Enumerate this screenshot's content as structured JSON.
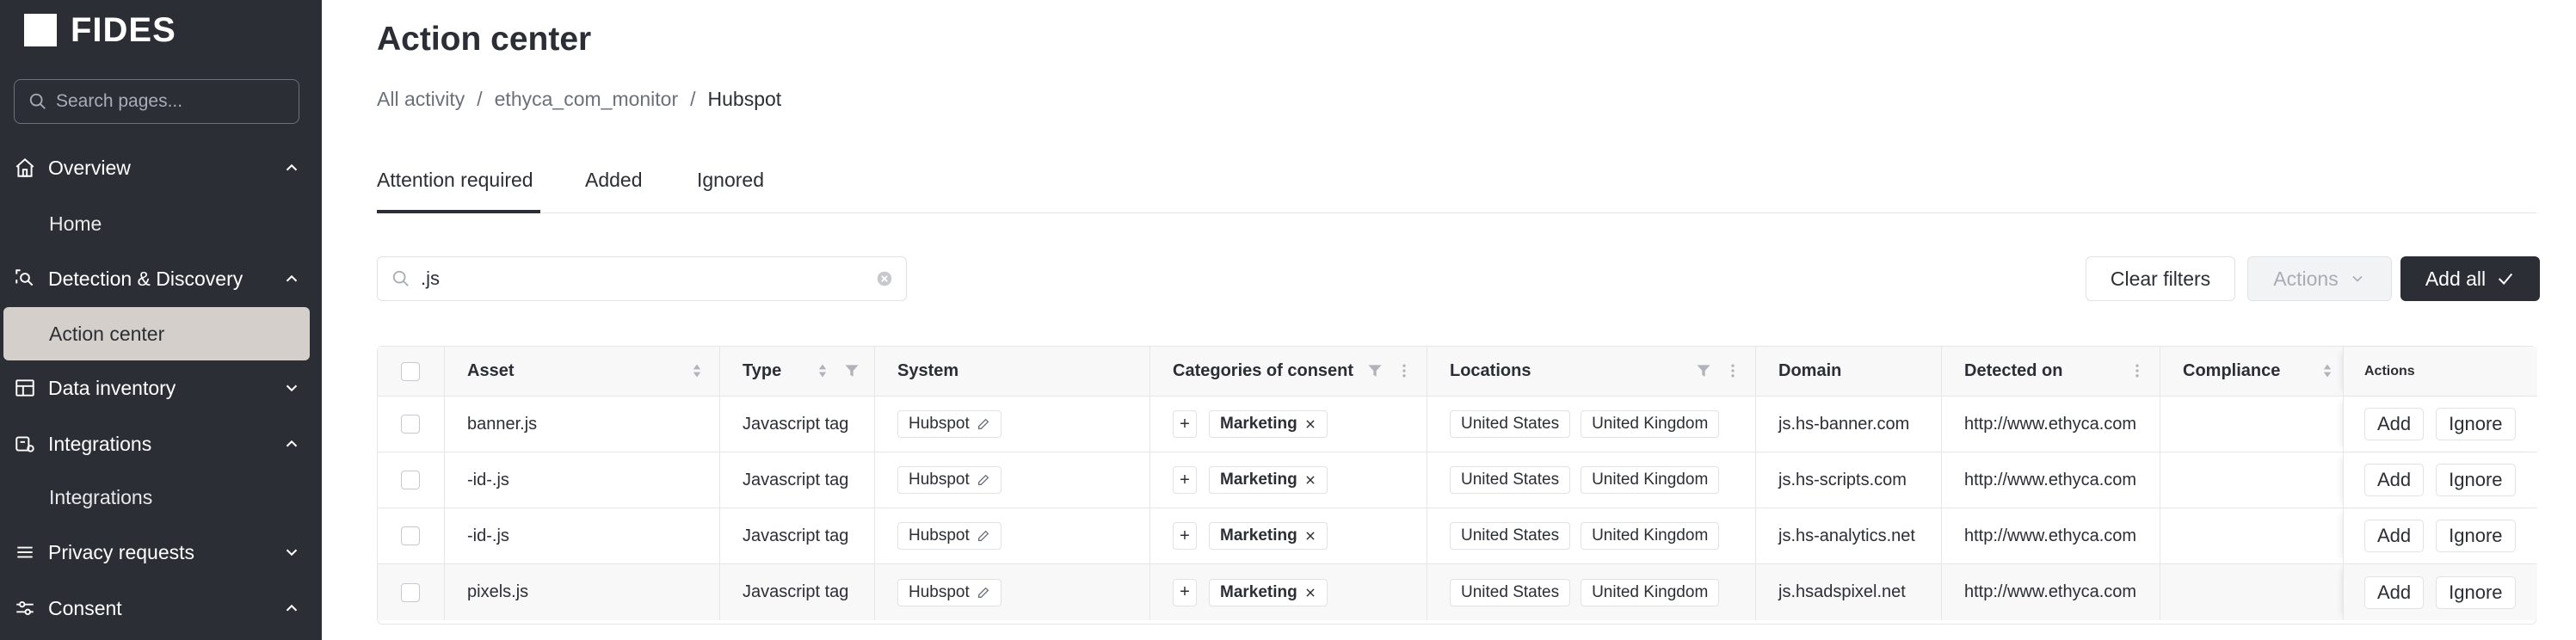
{
  "sidebar": {
    "logo_text": "FIDES",
    "search_placeholder": "Search pages...",
    "groups": [
      {
        "label": "Overview",
        "icon": "home-icon",
        "expanded": true
      },
      {
        "label": "Home"
      },
      {
        "label": "Detection & Discovery",
        "icon": "scan-search-icon",
        "expanded": true
      },
      {
        "label": "Action center",
        "active": true
      },
      {
        "label": "Data inventory",
        "icon": "table-icon",
        "expanded": false
      },
      {
        "label": "Integrations",
        "icon": "plug-icon",
        "expanded": true
      },
      {
        "label": "Integrations"
      },
      {
        "label": "Privacy requests",
        "icon": "stack-icon",
        "expanded": false
      },
      {
        "label": "Consent",
        "icon": "sliders-icon",
        "expanded": true
      }
    ]
  },
  "header": {
    "title": "Action center",
    "breadcrumb": [
      "All activity",
      "ethyca_com_monitor",
      "Hubspot"
    ],
    "breadcrumb_sep": "/"
  },
  "tabs": [
    {
      "label": "Attention required",
      "active": true
    },
    {
      "label": "Added"
    },
    {
      "label": "Ignored"
    }
  ],
  "toolbar": {
    "search_value": ".js",
    "clear_filters": "Clear filters",
    "actions": "Actions",
    "add_all": "Add all"
  },
  "table": {
    "columns": [
      "Asset",
      "Type",
      "System",
      "Categories of consent",
      "Locations",
      "Domain",
      "Detected on",
      "Compliance",
      "Actions"
    ],
    "rows": [
      {
        "asset": "banner.js",
        "type": "Javascript tag",
        "system": "Hubspot",
        "consent": "Marketing",
        "loc1": "United States",
        "loc2": "United Kingdom",
        "domain": "js.hs-banner.com",
        "detected": "http://www.ethyca.com",
        "compliance": "",
        "add": "Add",
        "ignore": "Ignore"
      },
      {
        "asset": "-id-.js",
        "type": "Javascript tag",
        "system": "Hubspot",
        "consent": "Marketing",
        "loc1": "United States",
        "loc2": "United Kingdom",
        "domain": "js.hs-scripts.com",
        "detected": "http://www.ethyca.com",
        "compliance": "",
        "add": "Add",
        "ignore": "Ignore"
      },
      {
        "asset": "-id-.js",
        "type": "Javascript tag",
        "system": "Hubspot",
        "consent": "Marketing",
        "loc1": "United States",
        "loc2": "United Kingdom",
        "domain": "js.hs-analytics.net",
        "detected": "http://www.ethyca.com",
        "compliance": "",
        "add": "Add",
        "ignore": "Ignore"
      },
      {
        "asset": "pixels.js",
        "type": "Javascript tag",
        "system": "Hubspot",
        "consent": "Marketing",
        "loc1": "United States",
        "loc2": "United Kingdom",
        "domain": "js.hsadspixel.net",
        "detected": "http://www.ethyca.com",
        "compliance": "",
        "add": "Add",
        "ignore": "Ignore"
      }
    ]
  }
}
